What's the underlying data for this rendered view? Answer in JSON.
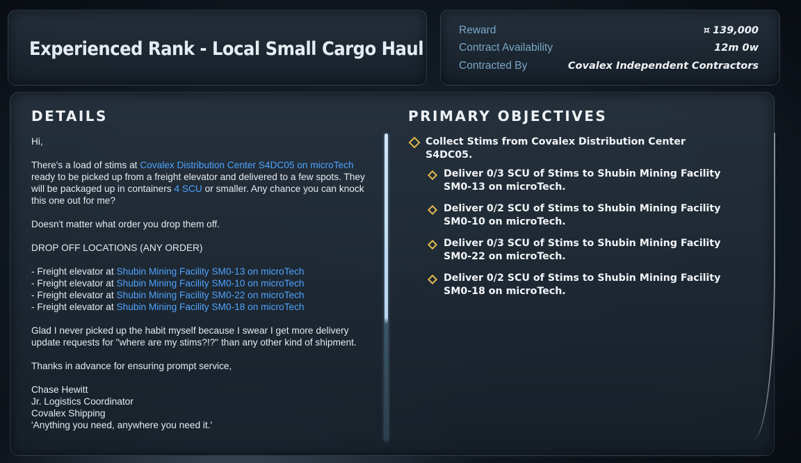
{
  "title_panel": {
    "title": "Experienced Rank - Local Small Cargo Haul"
  },
  "info": {
    "reward_label": "Reward",
    "reward_icon": "uec-currency-icon",
    "reward_symbol": "¤",
    "reward_value": "139,000",
    "availability_label": "Contract Availability",
    "availability_value": "12m 0w",
    "contracted_by_label": "Contracted By",
    "contracted_by_value": "Covalex Independent Contractors"
  },
  "details": {
    "heading": "DETAILS",
    "greeting": "Hi,",
    "p1_a": "There's a load of stims at ",
    "p1_link1": "Covalex Distribution Center S4DC05 on microTech",
    "p1_b": " ready to be picked up from a freight elevator and delivered to a few spots. They will be packaged up in containers ",
    "p1_link2": "4 SCU",
    "p1_c": " or smaller. Any chance you can knock this one out for me?",
    "p2": "Doesn't matter what order you drop them off.",
    "p3": "DROP OFF LOCATIONS (ANY ORDER)",
    "dropoff_prefix": "- Freight elevator at ",
    "dropoffs": [
      "Shubin Mining Facility SM0-13 on microTech",
      "Shubin Mining Facility SM0-10 on microTech",
      "Shubin Mining Facility SM0-22 on microTech",
      "Shubin Mining Facility SM0-18 on microTech"
    ],
    "p4": "Glad I never picked up the habit myself because I swear I get more delivery update requests for \"where are my stims?!?\" than any other kind of shipment.",
    "p5": "Thanks in advance for ensuring prompt service,",
    "sig_name": "Chase Hewitt",
    "sig_role": "Jr. Logistics Coordinator",
    "sig_company": "Covalex Shipping",
    "sig_motto": "'Anything you need, anywhere you need it.'"
  },
  "objectives": {
    "heading": "PRIMARY OBJECTIVES",
    "primary": "Collect Stims from Covalex Distribution Center S4DC05.",
    "subs": [
      "Deliver 0/3 SCU of Stims to Shubin Mining Facility SM0-13 on microTech.",
      "Deliver 0/2 SCU of Stims to Shubin Mining Facility SM0-10 on microTech.",
      "Deliver 0/3 SCU of Stims to Shubin Mining Facility SM0-22 on microTech.",
      "Deliver 0/2 SCU of Stims to Shubin Mining Facility SM0-18 on microTech."
    ],
    "bullet_icon": "diamond-icon",
    "bullet_color": "#e0b94c"
  },
  "colors": {
    "link": "#4fa3ff",
    "label": "#7aa7c8"
  }
}
